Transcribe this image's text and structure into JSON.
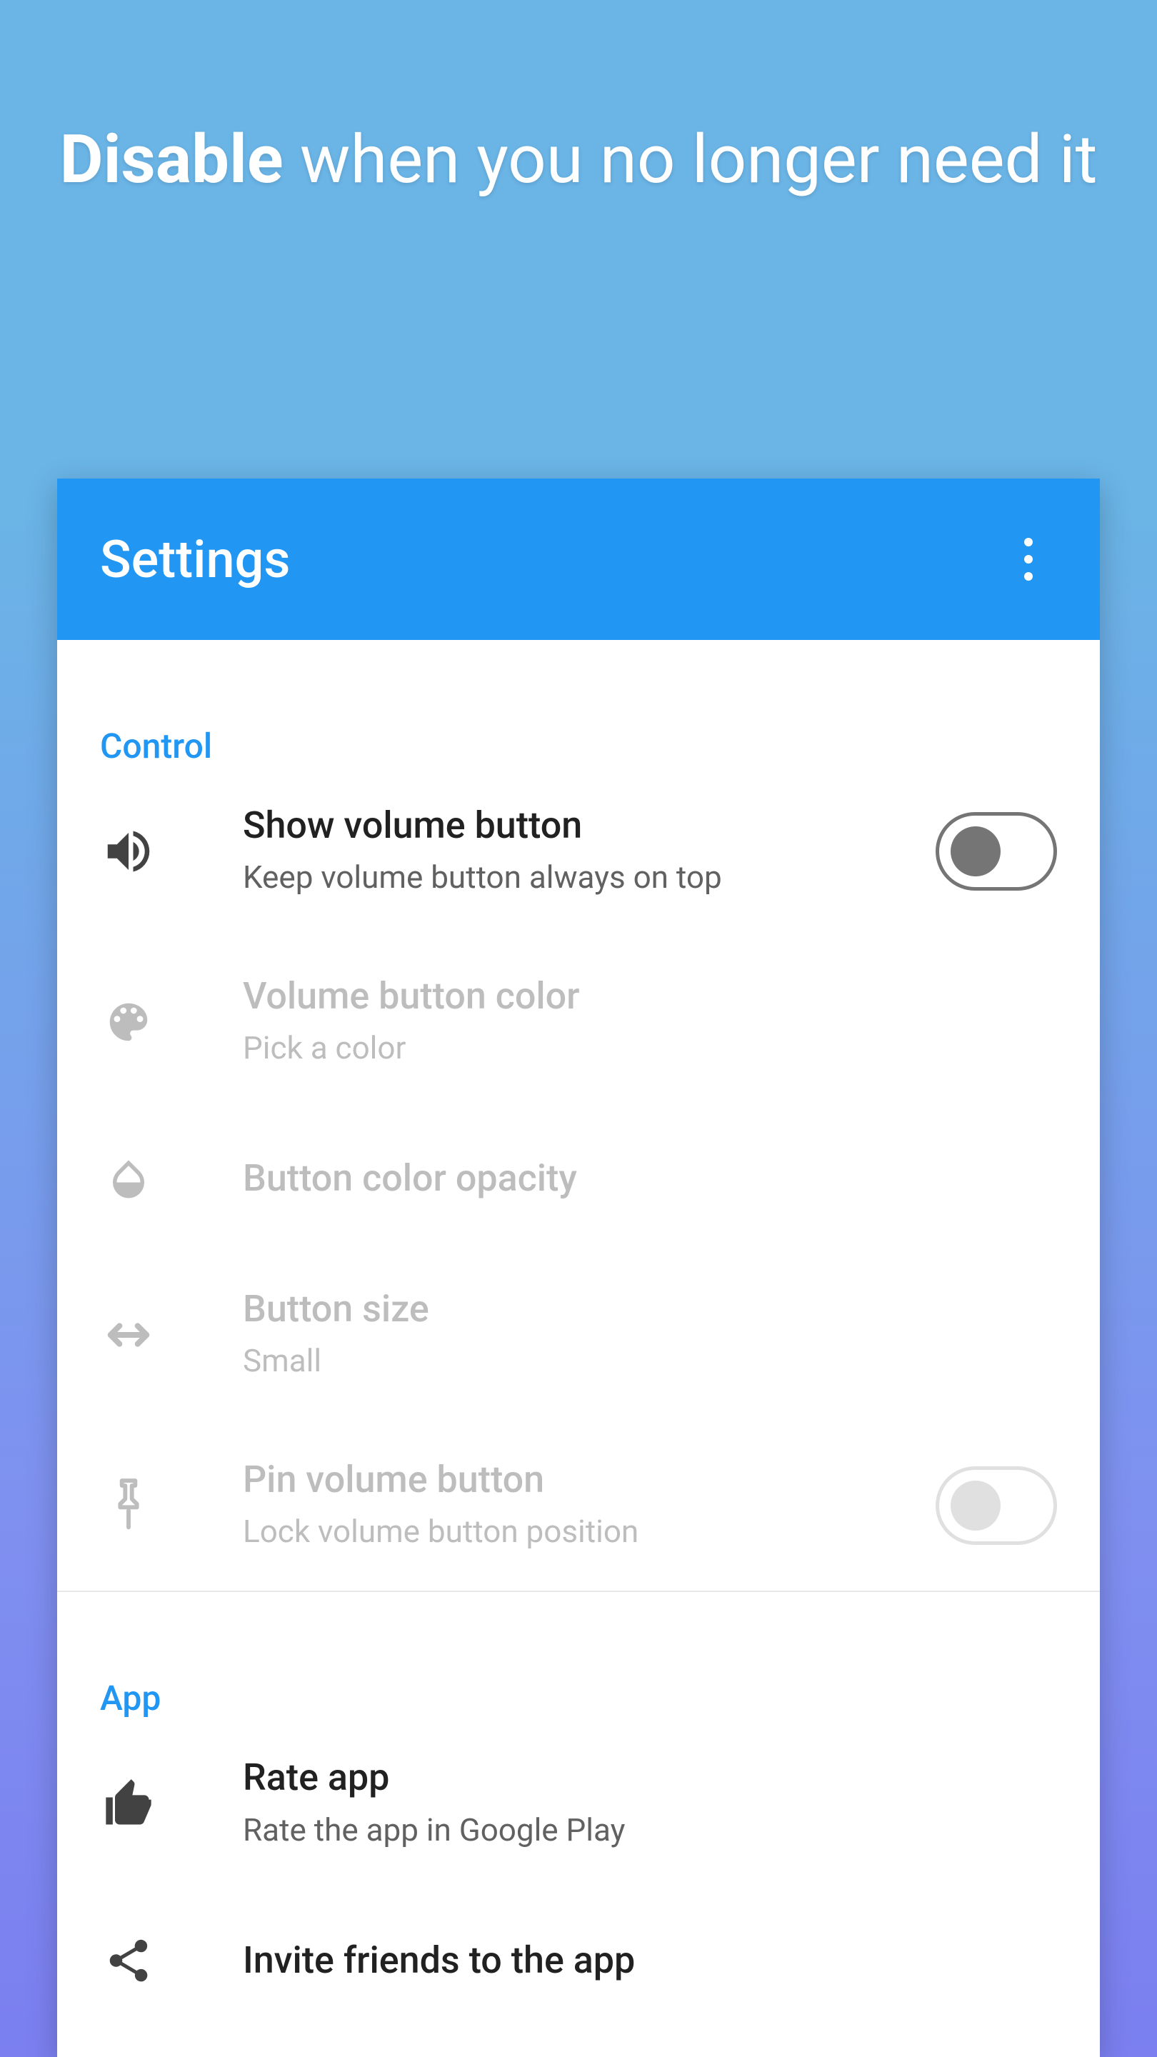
{
  "hero": {
    "bold": "Disable",
    "rest": " when you no longer need it"
  },
  "appbar": {
    "title": "Settings"
  },
  "sections": {
    "control": {
      "header": "Control",
      "show_volume": {
        "title": "Show volume button",
        "sub": "Keep volume button always on top",
        "checked": false
      },
      "color": {
        "title": "Volume button color",
        "sub": "Pick a color"
      },
      "opacity": {
        "title": "Button color opacity"
      },
      "size": {
        "title": "Button size",
        "sub": "Small"
      },
      "pin": {
        "title": "Pin volume button",
        "sub": "Lock volume button position",
        "checked": false
      }
    },
    "app": {
      "header": "App",
      "rate": {
        "title": "Rate app",
        "sub": "Rate the app in Google Play"
      },
      "invite": {
        "title": "Invite friends to the app"
      }
    }
  },
  "colors": {
    "accent": "#2196f3",
    "bg_top": "#6ab4e6",
    "bg_bottom": "#7b7ff0"
  }
}
